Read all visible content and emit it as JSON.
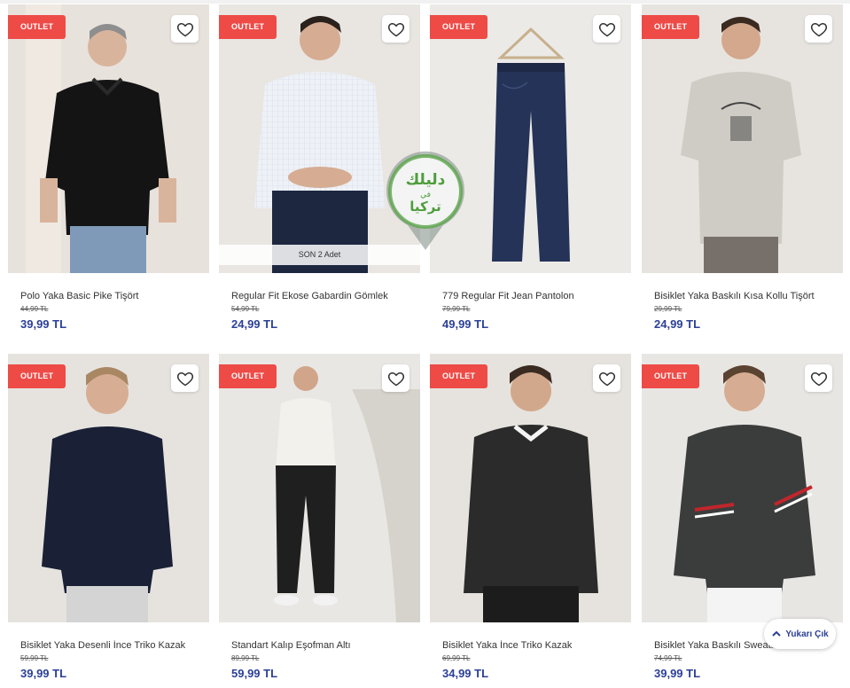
{
  "outlet_label": "OUTLET",
  "back_to_top_label": "Yukarı Çık",
  "watermark": {
    "line1": "دليلك",
    "line2": "في",
    "line3": "تركيا"
  },
  "colors": {
    "badge": "#ee4b47",
    "price": "#2c4097"
  },
  "products": [
    {
      "name": "Polo Yaka Basic Pike Tişört",
      "old_price": "44,99 TL",
      "price": "39,99 TL",
      "stock": ""
    },
    {
      "name": "Regular Fit Ekose Gabardin Gömlek",
      "old_price": "54,99 TL",
      "price": "24,99 TL",
      "stock": "SON 2 Adet"
    },
    {
      "name": "779 Regular Fit Jean Pantolon",
      "old_price": "79,99 TL",
      "price": "49,99 TL",
      "stock": ""
    },
    {
      "name": "Bisiklet Yaka Baskılı Kısa Kollu Tişört",
      "old_price": "29,99 TL",
      "price": "24,99 TL",
      "stock": ""
    },
    {
      "name": "Bisiklet Yaka Desenli İnce Triko Kazak",
      "old_price": "59,99 TL",
      "price": "39,99 TL",
      "stock": ""
    },
    {
      "name": "Standart Kalıp Eşofman Altı",
      "old_price": "89,99 TL",
      "price": "59,99 TL",
      "stock": ""
    },
    {
      "name": "Bisiklet Yaka İnce Triko Kazak",
      "old_price": "69,99 TL",
      "price": "34,99 TL",
      "stock": ""
    },
    {
      "name": "Bisiklet Yaka Baskılı Sweatshirt",
      "old_price": "74,99 TL",
      "price": "39,99 TL",
      "stock": ""
    }
  ]
}
